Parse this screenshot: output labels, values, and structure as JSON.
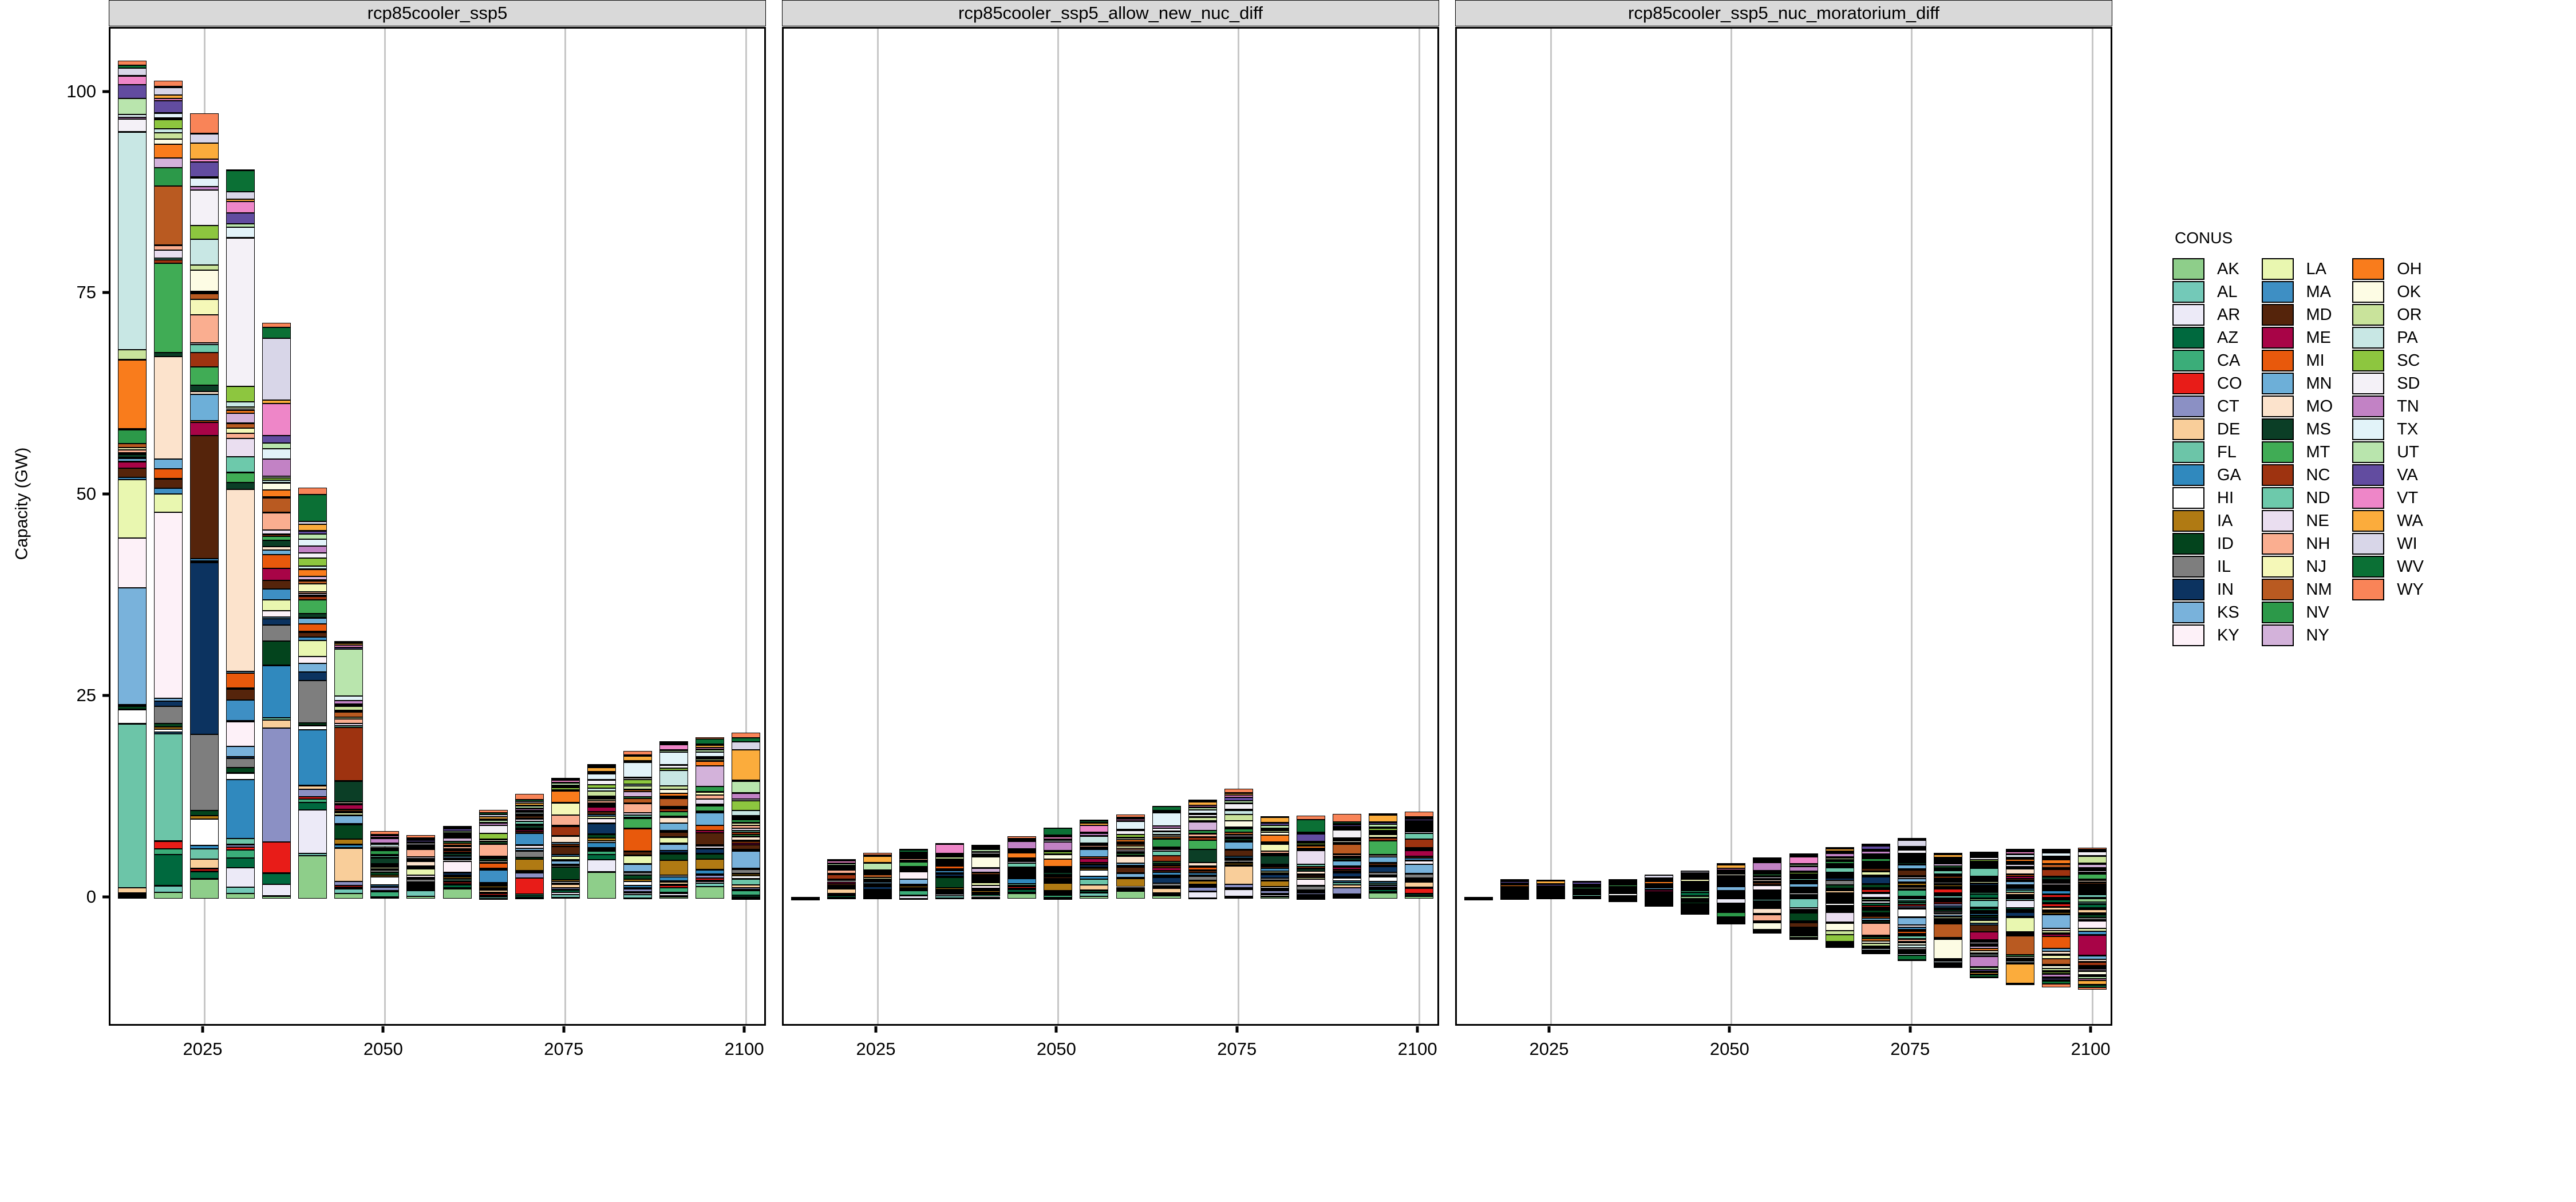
{
  "chart_data": {
    "type": "bar",
    "subtype": "stacked-bar-faceted",
    "title": "",
    "xlabel": "",
    "ylabel": "Capacity (GW)",
    "ylim": [
      -16,
      108
    ],
    "y_ticks": [
      0,
      25,
      50,
      75,
      100
    ],
    "xlim": [
      2012,
      2103
    ],
    "x_ticks": [
      2025,
      2050,
      2075,
      2100
    ],
    "grid": "vertical-only",
    "legend_title": "CONUS",
    "legend_position": "right",
    "facets": [
      "rcp85cooler_ssp5",
      "rcp85cooler_ssp5_allow_new_nuc_diff",
      "rcp85cooler_ssp5_nuc_moratorium_diff"
    ],
    "categories": [
      2015,
      2020,
      2025,
      2030,
      2035,
      2040,
      2045,
      2050,
      2055,
      2060,
      2065,
      2070,
      2075,
      2080,
      2085,
      2090,
      2095,
      2100
    ],
    "panels": [
      {
        "name": "rcp85cooler_ssp5",
        "totals": [
          104.0,
          101.5,
          97.5,
          90.5,
          71.5,
          51.0,
          32.0,
          8.4,
          7.9,
          9.0,
          11.0,
          13.0,
          15.0,
          16.7,
          18.3,
          19.5,
          20.0,
          20.6
        ]
      },
      {
        "name": "rcp85cooler_ssp5_allow_new_nuc_diff",
        "totals": [
          0.0,
          4.9,
          5.7,
          6.2,
          6.9,
          6.7,
          7.7,
          8.8,
          9.8,
          10.4,
          11.5,
          12.3,
          13.6,
          10.2,
          10.3,
          10.5,
          10.6,
          10.8
        ]
      },
      {
        "name": "rcp85cooler_ssp5_nuc_moratorium_diff",
        "totals": [
          0.0,
          2.4,
          2.3,
          2.2,
          2.4,
          3.0,
          3.5,
          4.4,
          5.1,
          5.6,
          6.4,
          6.8,
          7.5,
          5.7,
          5.8,
          6.2,
          6.2,
          6.3
        ],
        "negative_totals": [
          0.0,
          0.0,
          0.0,
          0.0,
          -0.3,
          -0.9,
          -1.9,
          -3.1,
          -4.2,
          -5.1,
          -6.0,
          -6.8,
          -7.6,
          -8.6,
          -9.8,
          -10.6,
          -11.0,
          -11.3
        ]
      }
    ],
    "series": [
      {
        "name": "AK",
        "color": "#8ECE8A"
      },
      {
        "name": "AL",
        "color": "#73C9B8"
      },
      {
        "name": "AR",
        "color": "#ECEAF7"
      },
      {
        "name": "AZ",
        "color": "#00693E"
      },
      {
        "name": "CA",
        "color": "#3BAD79"
      },
      {
        "name": "CO",
        "color": "#E81C18"
      },
      {
        "name": "CT",
        "color": "#8B90C4"
      },
      {
        "name": "DE",
        "color": "#F9CE9A"
      },
      {
        "name": "FL",
        "color": "#6CC5A8"
      },
      {
        "name": "GA",
        "color": "#3089BE"
      },
      {
        "name": "HI",
        "color": "#FFFFFF"
      },
      {
        "name": "IA",
        "color": "#B07A13"
      },
      {
        "name": "ID",
        "color": "#03441D"
      },
      {
        "name": "IL",
        "color": "#7E7E7E"
      },
      {
        "name": "IN",
        "color": "#0C3360"
      },
      {
        "name": "KS",
        "color": "#79B2DB"
      },
      {
        "name": "KY",
        "color": "#FDF1F8"
      },
      {
        "name": "LA",
        "color": "#E9F7B0"
      },
      {
        "name": "MA",
        "color": "#3E8FC4"
      },
      {
        "name": "MD",
        "color": "#55240B"
      },
      {
        "name": "ME",
        "color": "#A80447"
      },
      {
        "name": "MI",
        "color": "#E8590C"
      },
      {
        "name": "MN",
        "color": "#6DAFD8"
      },
      {
        "name": "MO",
        "color": "#FCE3CC"
      },
      {
        "name": "MS",
        "color": "#0B3E26"
      },
      {
        "name": "MT",
        "color": "#40AC55"
      },
      {
        "name": "NC",
        "color": "#9E3310"
      },
      {
        "name": "ND",
        "color": "#6DC9AB"
      },
      {
        "name": "NE",
        "color": "#EADEF0"
      },
      {
        "name": "NH",
        "color": "#FAAE90"
      },
      {
        "name": "NJ",
        "color": "#F5F8B8"
      },
      {
        "name": "NM",
        "color": "#B95A21"
      },
      {
        "name": "NV",
        "color": "#2C9949"
      },
      {
        "name": "NY",
        "color": "#D3B2DA"
      },
      {
        "name": "OH",
        "color": "#F97C1C"
      },
      {
        "name": "OK",
        "color": "#FDFCE4"
      },
      {
        "name": "OR",
        "color": "#C9E39B"
      },
      {
        "name": "PA",
        "color": "#C8E7E4"
      },
      {
        "name": "SC",
        "color": "#8DC63F"
      },
      {
        "name": "SD",
        "color": "#F4F1F7"
      },
      {
        "name": "TN",
        "color": "#C282C5"
      },
      {
        "name": "TX",
        "color": "#E2F3F9"
      },
      {
        "name": "UT",
        "color": "#B9E5AD"
      },
      {
        "name": "VA",
        "color": "#624CA0"
      },
      {
        "name": "VT",
        "color": "#EE86C8"
      },
      {
        "name": "WA",
        "color": "#FBAC3C"
      },
      {
        "name": "WI",
        "color": "#D8D6E8"
      },
      {
        "name": "WV",
        "color": "#0B7035"
      },
      {
        "name": "WY",
        "color": "#F98458"
      }
    ]
  },
  "axes": {
    "y_title": "Capacity (GW)",
    "y_tick_labels": [
      "0",
      "25",
      "50",
      "75",
      "100"
    ],
    "x_tick_labels": [
      "2025",
      "2050",
      "2075",
      "2100"
    ]
  },
  "facet_strips": [
    {
      "label": "rcp85cooler_ssp5"
    },
    {
      "label": "rcp85cooler_ssp5_allow_new_nuc_diff"
    },
    {
      "label": "rcp85cooler_ssp5_nuc_moratorium_diff"
    }
  ],
  "legend": {
    "title": "CONUS",
    "columns": [
      [
        "AK",
        "AL",
        "AR",
        "AZ",
        "CA",
        "CO",
        "CT",
        "DE",
        "FL",
        "GA",
        "HI",
        "IA",
        "ID",
        "IL",
        "IN",
        "KS",
        "KY"
      ],
      [
        "LA",
        "MA",
        "MD",
        "ME",
        "MI",
        "MN",
        "MO",
        "MS",
        "MT",
        "NC",
        "ND",
        "NE",
        "NH",
        "NJ",
        "NM",
        "NV",
        "NY"
      ],
      [
        "OH",
        "OK",
        "OR",
        "PA",
        "SC",
        "SD",
        "TN",
        "TX",
        "UT",
        "VA",
        "VT",
        "WA",
        "WI",
        "WV",
        "WY"
      ]
    ]
  },
  "colors": {
    "strip_background": "#d9d9d9",
    "panel_border": "#000000",
    "gridline": "#c7c7c7",
    "background": "#ffffff"
  }
}
